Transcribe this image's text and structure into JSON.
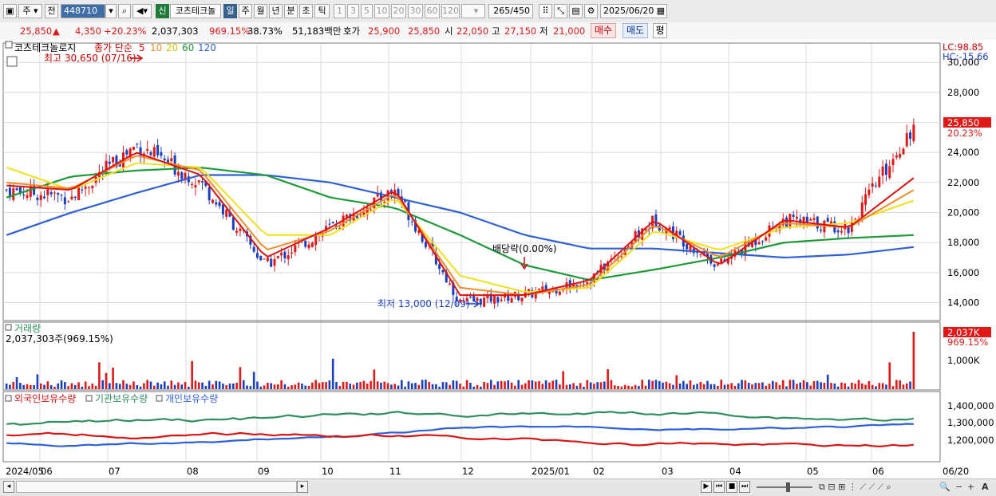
{
  "toolbar": {
    "market": "주",
    "prev_label": "전",
    "code": "448710",
    "new_badge": "신",
    "stock_name": "코츠테크놀",
    "periods": [
      "일",
      "주",
      "월",
      "년",
      "분",
      "초",
      "틱"
    ],
    "active_period": "일",
    "intervals": [
      "1",
      "3",
      "5",
      "10",
      "20",
      "30",
      "60",
      "120"
    ],
    "count_current": "265",
    "count_total": "/450",
    "date": "2025/06/20"
  },
  "info": {
    "price": "25,850",
    "up_arrow": "▲",
    "change": "4,350",
    "change_pct": "+20.23%",
    "volume": "2,037,303",
    "volume_ratio": "969.15%",
    "turnover": "38.73%",
    "amount": "51,183백만",
    "quote_label": "호가",
    "ask": "25,900",
    "bid": "25,850",
    "open_label": "시",
    "open": "22,050",
    "high_label": "고",
    "high": "27,150",
    "low_label": "저",
    "low": "21,000",
    "buy": "매수",
    "sell": "매도",
    "eval": "평"
  },
  "price_panel": {
    "title": "코츠테크놀로지",
    "ma_label": "종가 단순",
    "ma_periods": [
      "5",
      "10",
      "20",
      "60",
      "120"
    ],
    "lc": "LC:98.85",
    "hc": "HC:-15.66",
    "high_note": "최고 30,650 (07/16)",
    "low_note": "최저 13,000 (12/09)",
    "dividend_note": "배당락(0.00%)",
    "last_price_tag": "25,850",
    "last_pct_tag": "20.23%",
    "y_ticks": [
      "30,000",
      "28,000",
      "26,000",
      "24,000",
      "22,000",
      "20,000",
      "18,000",
      "16,000",
      "14,000"
    ]
  },
  "volume_panel": {
    "title": "거래량",
    "value": "2,037,303주(969.15%)",
    "last_tag": "2,037K",
    "last_pct": "969.15%",
    "y_ticks": [
      "1,000K"
    ]
  },
  "holdings_panel": {
    "legend": [
      "외국인보유수량",
      "기관보유수량",
      "개인보유수량"
    ],
    "y_ticks": [
      "1,400,000",
      "1,300,000",
      "1,200,000"
    ]
  },
  "x_axis": {
    "labels": [
      "2024/05",
      "06",
      "07",
      "08",
      "09",
      "10",
      "11",
      "12",
      "2025/01",
      "02",
      "03",
      "04",
      "05",
      "06",
      "06/20"
    ]
  },
  "colors": {
    "up": "#e01818",
    "down": "#1b3fbf",
    "ma5": "#dd1111",
    "ma10": "#f28c28",
    "ma20": "#f2e11a",
    "ma60": "#1f9a3a",
    "ma120": "#2f5fd8",
    "foreign": "#d81515",
    "institution": "#2f8f5f",
    "individual": "#2f5fd8"
  },
  "chart_data": {
    "type": "candlestick",
    "x": [
      "2024/05",
      "2024/06",
      "2024/07",
      "2024/08",
      "2024/09",
      "2024/10",
      "2024/11",
      "2024/12",
      "2025/01",
      "2025/02",
      "2025/03",
      "2025/04",
      "2025/05",
      "2025/06",
      "2025/06/20"
    ],
    "close": [
      21500,
      21000,
      24500,
      22000,
      16500,
      19000,
      21500,
      14000,
      14500,
      15500,
      19500,
      16500,
      19500,
      19000,
      25850
    ],
    "ma5": [
      21800,
      21500,
      24000,
      22500,
      17000,
      19000,
      21500,
      14500,
      14500,
      15500,
      19500,
      16500,
      19500,
      19000,
      22300
    ],
    "ma10": [
      22000,
      21600,
      23800,
      22800,
      17500,
      18800,
      21300,
      15000,
      14500,
      15200,
      19200,
      17000,
      19300,
      19000,
      21500
    ],
    "ma20": [
      23000,
      21500,
      23300,
      23000,
      18500,
      18500,
      21000,
      15800,
      14700,
      15000,
      18800,
      17500,
      19000,
      19300,
      20800
    ],
    "ma60": [
      21000,
      22400,
      22800,
      23000,
      22500,
      21000,
      20300,
      18500,
      16500,
      15500,
      16200,
      17000,
      18000,
      18300,
      18500
    ],
    "ma120": [
      18500,
      20000,
      21300,
      22500,
      22500,
      22000,
      21000,
      20000,
      18500,
      17600,
      17600,
      17300,
      17000,
      17200,
      17700
    ],
    "high": 30650,
    "low": 13000,
    "ylim": [
      13000,
      30650
    ],
    "volume_last": 2037303
  }
}
